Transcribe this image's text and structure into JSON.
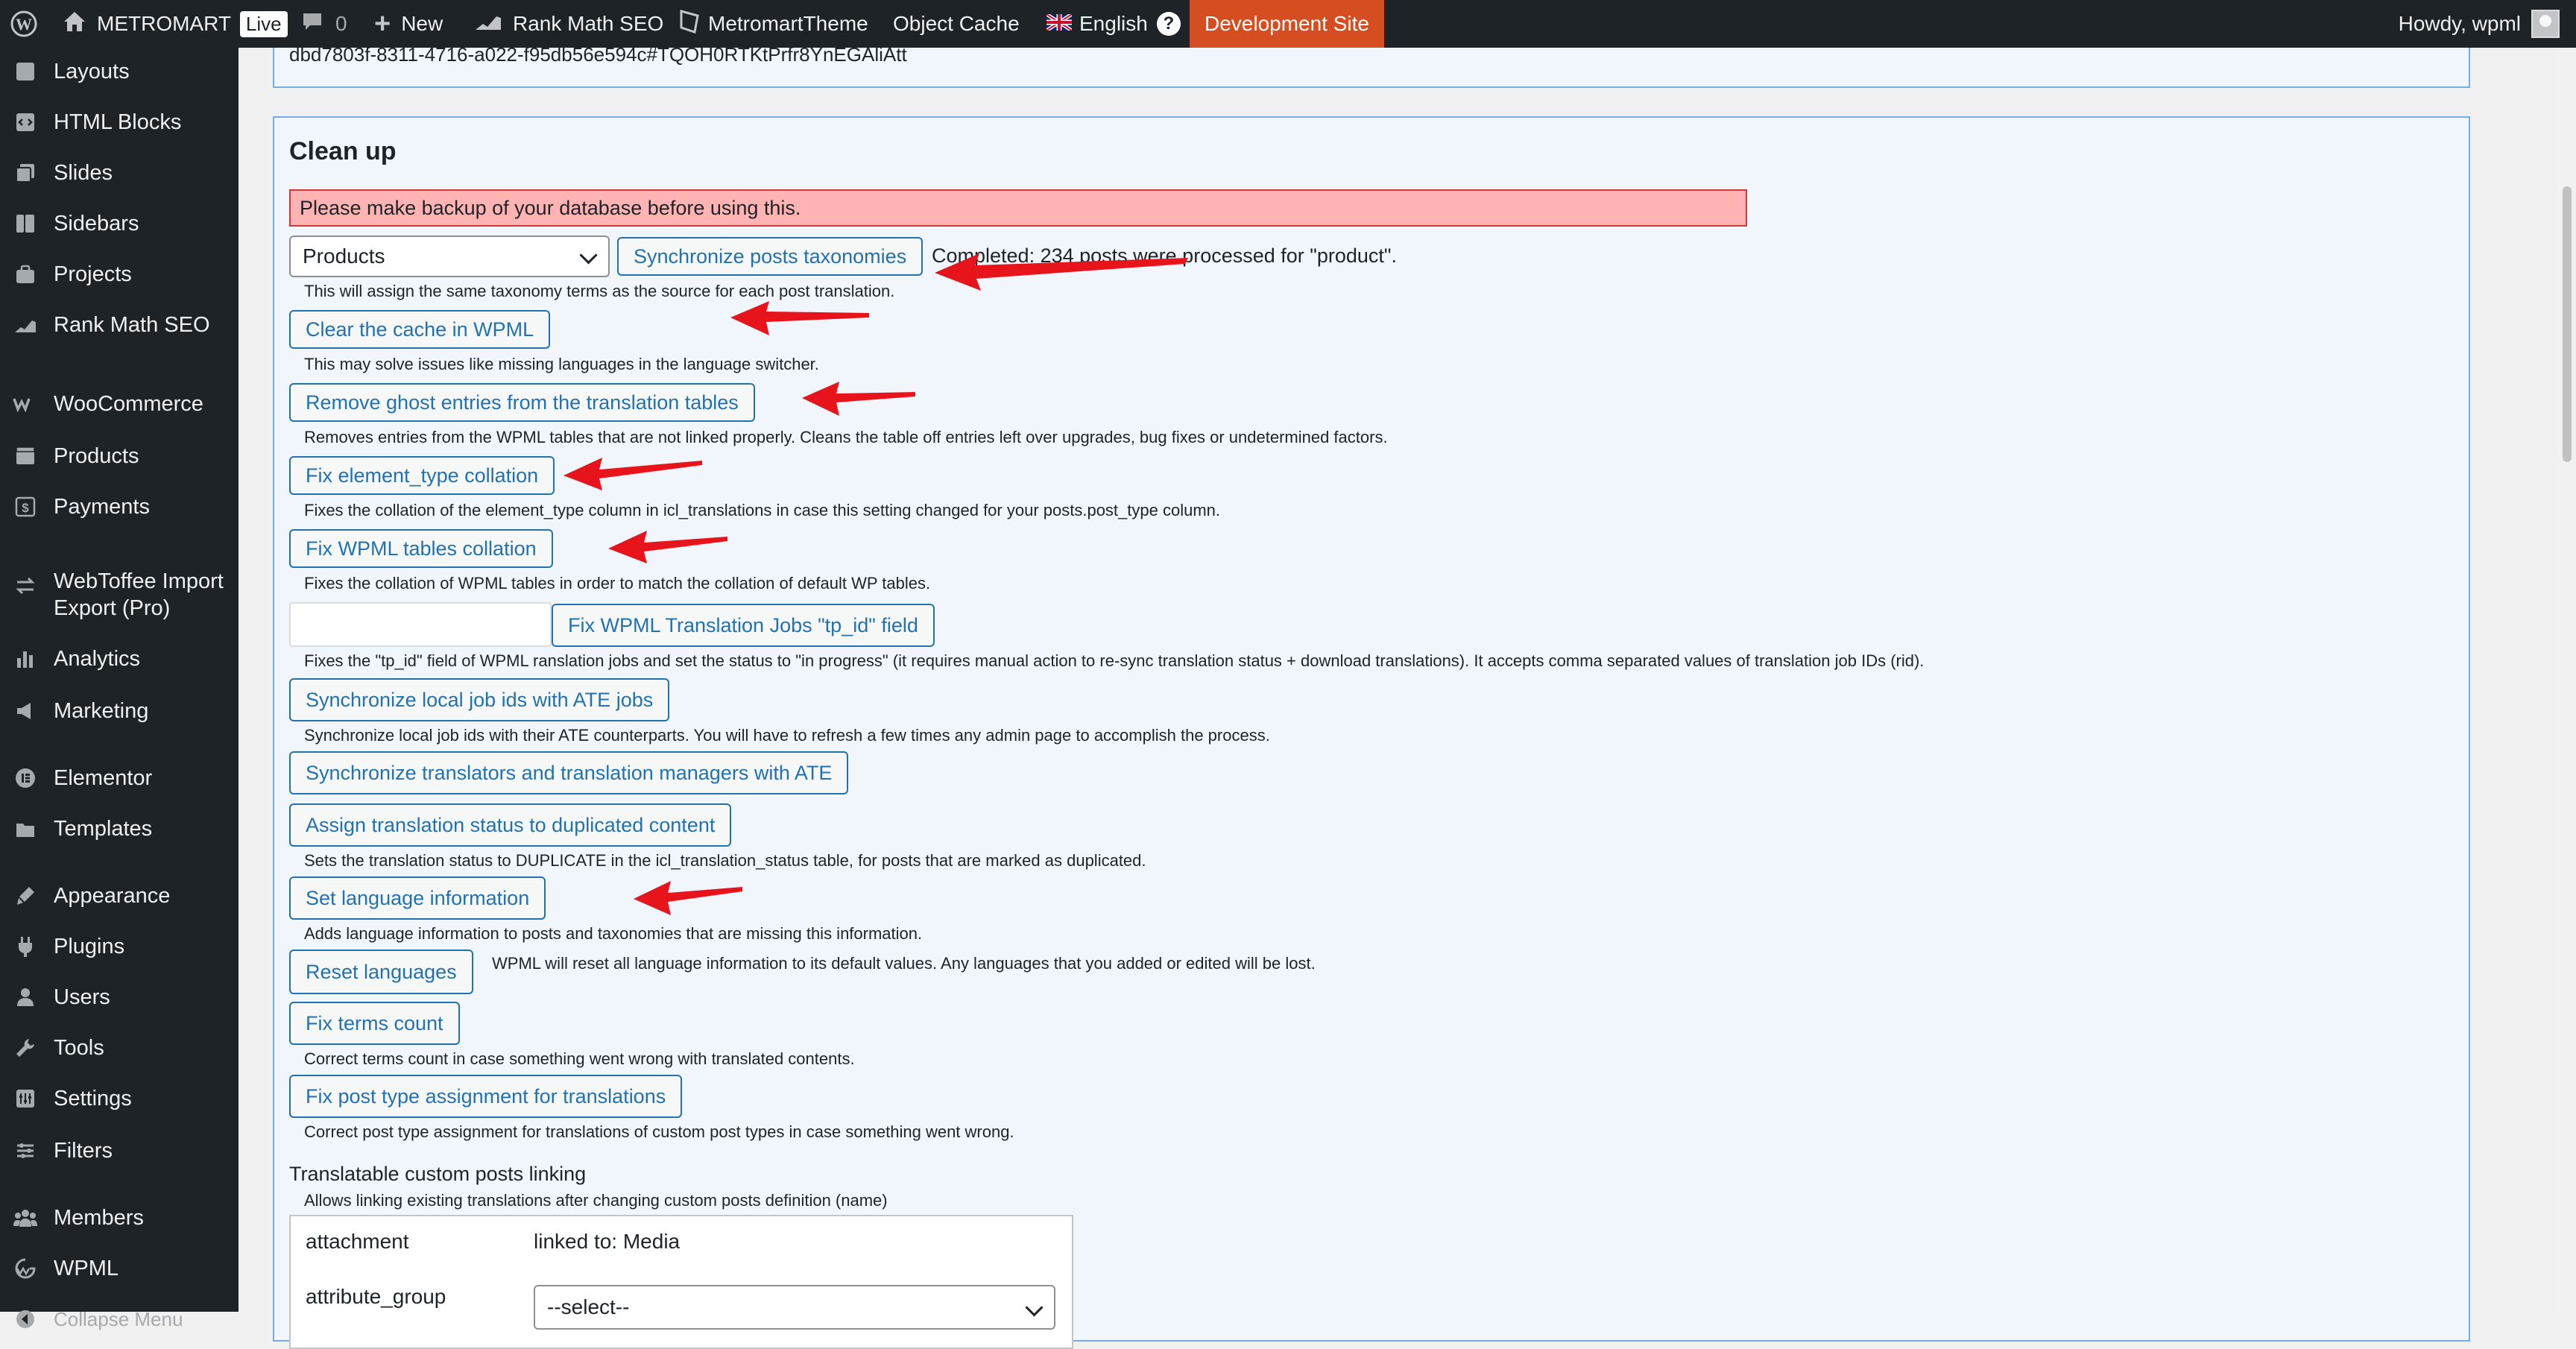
{
  "admin_bar": {
    "site_name": "METROMART",
    "live_badge": "Live",
    "comments_count": "0",
    "new_label": "New",
    "rank_math": "Rank Math SEO",
    "theme": "MetromartTheme",
    "object_cache": "Object Cache",
    "language": "English",
    "help_glyph": "?",
    "dev_site": "Development Site",
    "howdy": "Howdy, wpml"
  },
  "sidebar": {
    "items": [
      {
        "label": "Layouts",
        "icon": "layouts-icon"
      },
      {
        "label": "HTML Blocks",
        "icon": "html-blocks-icon"
      },
      {
        "label": "Slides",
        "icon": "slides-icon"
      },
      {
        "label": "Sidebars",
        "icon": "sidebars-icon"
      },
      {
        "label": "Projects",
        "icon": "projects-icon"
      },
      {
        "label": "Rank Math SEO",
        "icon": "rank-math-icon"
      },
      {
        "label": "WooCommerce",
        "icon": "woocommerce-icon"
      },
      {
        "label": "Products",
        "icon": "products-icon"
      },
      {
        "label": "Payments",
        "icon": "payments-icon"
      },
      {
        "label": "WebToffee Import Export (Pro)",
        "icon": "webtoffee-icon"
      },
      {
        "label": "Analytics",
        "icon": "analytics-icon"
      },
      {
        "label": "Marketing",
        "icon": "marketing-icon"
      },
      {
        "label": "Elementor",
        "icon": "elementor-icon"
      },
      {
        "label": "Templates",
        "icon": "templates-icon"
      },
      {
        "label": "Appearance",
        "icon": "appearance-icon"
      },
      {
        "label": "Plugins",
        "icon": "plugins-icon"
      },
      {
        "label": "Users",
        "icon": "users-icon"
      },
      {
        "label": "Tools",
        "icon": "tools-icon"
      },
      {
        "label": "Settings",
        "icon": "settings-icon"
      },
      {
        "label": "Filters",
        "icon": "filters-icon"
      },
      {
        "label": "Members",
        "icon": "members-icon"
      },
      {
        "label": "WPML",
        "icon": "wpml-icon"
      }
    ],
    "collapse_label": "Collapse Menu"
  },
  "top_box_text": "dbd7803f-8311-4716-a022-f95db56e594c#TQOH0RTKtPrfr8YnEGAliAtt",
  "cleanup": {
    "title": "Clean up",
    "backup_warning": "Please make backup of your database before using this.",
    "post_type_select": "Products",
    "sync_taxonomies_button": "Synchronize posts taxonomies",
    "sync_status": "Completed: 234 posts were processed for \"product\".",
    "sync_taxonomies_desc": "This will assign the same taxonomy terms as the source for each post translation.",
    "clear_cache_button": "Clear the cache in WPML",
    "clear_cache_desc": "This may solve issues like missing languages in the language switcher.",
    "ghost_button": "Remove ghost entries from the translation tables",
    "ghost_desc": "Removes entries from the WPML tables that are not linked properly. Cleans the table off entries left over upgrades, bug fixes or undetermined factors.",
    "element_type_button": "Fix element_type collation",
    "element_type_desc": "Fixes the collation of the element_type column in icl_translations in case this setting changed for your posts.post_type column.",
    "tables_collation_button": "Fix WPML tables collation",
    "tables_collation_desc": "Fixes the collation of WPML tables in order to match the collation of default WP tables.",
    "tpid_input_value": "",
    "tpid_button": "Fix WPML Translation Jobs \"tp_id\" field",
    "tpid_desc": "Fixes the \"tp_id\" field of WPML ranslation jobs and set the status to \"in progress\" (it requires manual action to re-sync translation status + download translations). It accepts comma separated values of translation job IDs (rid).",
    "sync_jobs_button": "Synchronize local job ids with ATE jobs",
    "sync_jobs_desc": "Synchronize local job ids with their ATE counterparts. You will have to refresh a few times any admin page to accomplish the process.",
    "sync_translators_button": "Synchronize translators and translation managers with ATE",
    "duplicated_button": "Assign translation status to duplicated content",
    "duplicated_desc": "Sets the translation status to DUPLICATE in the icl_translation_status table, for posts that are marked as duplicated.",
    "lang_info_button": "Set language information",
    "lang_info_desc": "Adds language information to posts and taxonomies that are missing this information.",
    "reset_button": "Reset languages",
    "reset_desc": "WPML will reset all language information to its default values. Any languages that you added or edited will be lost.",
    "terms_count_button": "Fix terms count",
    "terms_count_desc": "Correct terms count in case something went wrong with translated contents.",
    "post_type_button": "Fix post type assignment for translations",
    "post_type_desc": "Correct post type assignment for translations of custom post types in case something went wrong.",
    "tcp_heading": "Translatable custom posts linking",
    "tcp_desc": "Allows linking existing translations after changing custom posts definition (name)",
    "tcp_rows": [
      {
        "type": "attachment",
        "link": "linked to: Media"
      },
      {
        "type": "attribute_group",
        "select": "--select--"
      }
    ]
  },
  "colors": {
    "admin_dark": "#1d2327",
    "accent_blue": "#2271b1",
    "panel_bg": "#f0f6fc",
    "warning_bg": "#ffb3b3",
    "dev_site_bg": "#d54e21",
    "annotation_arrow": "#e8141b"
  }
}
